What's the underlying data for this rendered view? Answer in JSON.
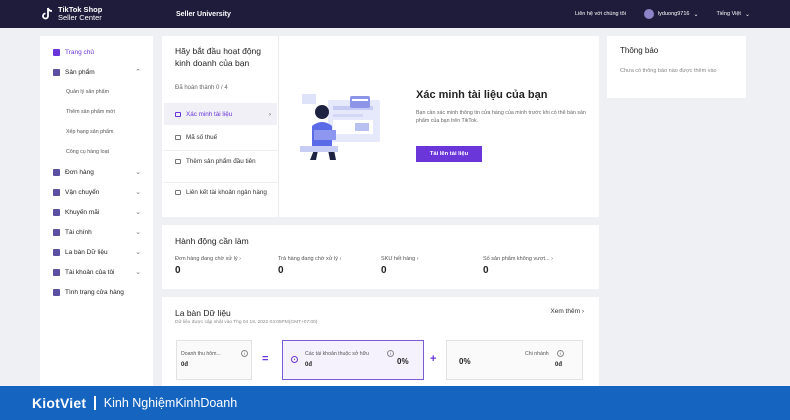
{
  "topbar": {
    "logo_line1": "TikTok Shop",
    "logo_line2": "Seller Center",
    "title": "Seller University",
    "contact": "Liên hệ với chúng tôi",
    "username": "lyduong9716",
    "language": "Tiếng Việt"
  },
  "sidebar": {
    "items": [
      {
        "label": "Trang chủ",
        "icon": "home-icon"
      },
      {
        "label": "Sản phẩm",
        "icon": "product-icon"
      },
      {
        "label": "Đơn hàng",
        "icon": "order-icon"
      },
      {
        "label": "Vận chuyển",
        "icon": "shipping-icon"
      },
      {
        "label": "Khuyến mãi",
        "icon": "promotion-icon"
      },
      {
        "label": "Tài chính",
        "icon": "finance-icon"
      },
      {
        "label": "La bàn Dữ liệu",
        "icon": "compass-icon"
      },
      {
        "label": "Tài khoản của tôi",
        "icon": "account-icon"
      },
      {
        "label": "Tình trạng cửa hàng",
        "icon": "shop-health-icon"
      }
    ],
    "product_subitems": [
      "Quản lý sản phẩm",
      "Thêm sản phẩm mới",
      "Xếp hạng sản phẩm",
      "Công cụ hàng loạt"
    ]
  },
  "onboarding": {
    "title": "Hãy bắt đầu hoạt động kinh doanh của bạn",
    "progress": "Đã hoàn thành 0 / 4",
    "steps": [
      "Xác minh tài liệu",
      "Mã số thuế",
      "Thêm sản phẩm đầu tiên",
      "Liên kết tài khoản ngân hàng"
    ],
    "heading": "Xác minh tài liệu của bạn",
    "description": "Bạn cần xác minh thông tin cửa hàng của mình trước khi có thể bán sản phẩm của bạn trên TikTok.",
    "button": "Tải lên tài liệu"
  },
  "notice": {
    "title": "Thông báo",
    "empty": "Chưa có thông báo nào được thêm vào"
  },
  "actions": {
    "title": "Hành động cần làm",
    "items": [
      {
        "label": "Đơn hàng đang chờ xử lý",
        "value": "0"
      },
      {
        "label": "Trả hàng đang chờ xử lý",
        "value": "0"
      },
      {
        "label": "SKU hết hàng",
        "value": "0"
      },
      {
        "label": "Số sản phẩm không vượt...",
        "value": "0"
      }
    ]
  },
  "compass": {
    "title": "La bàn Dữ liệu",
    "updated": "Dữ liệu được cập nhật vào Thg 04 19, 2022 04:05PM(GMT+07:00)",
    "more": "Xem thêm",
    "revenue_label": "Doanh thu hôm...",
    "revenue_value": "0đ",
    "eq": "=",
    "accounts_label": "Các tài khoản thuộc sở hữu",
    "accounts_value": "0đ",
    "accounts_pct": "0%",
    "plus": "+",
    "branch_pct": "0%",
    "branch_label": "Chi nhánh",
    "branch_value": "0đ"
  },
  "footer": {
    "brand": "KiotViet",
    "tagline": "Kinh NghiệmKinhDoanh"
  },
  "colors": {
    "topbar": "#1f1b3a",
    "accent": "#6a35d9",
    "footer": "#1565c0"
  }
}
